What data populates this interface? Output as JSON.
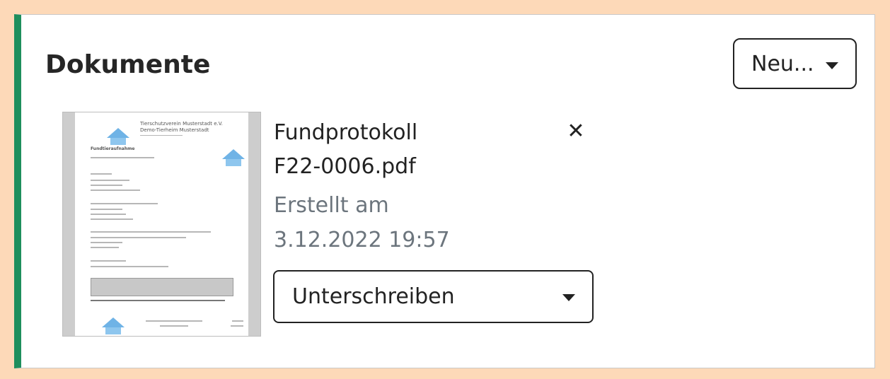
{
  "section": {
    "title": "Dokumente",
    "new_button_label": "Neu..."
  },
  "document": {
    "name": "Fundprotokoll F22-0006.pdf",
    "created_label": "Erstellt am",
    "created_date": "3.12.2022 19:57",
    "action_select_value": "Unterschreiben",
    "remove_icon": "close-icon"
  },
  "thumbnail": {
    "org_line1": "Tierschutzverein Musterstadt e.V.",
    "org_line2": "Demo-Tierheim Musterstadt",
    "heading": "Fundtieraufnahme"
  },
  "colors": {
    "accent": "#1e8f5d",
    "background": "#fdd9b8",
    "muted_text": "#6c757d"
  }
}
